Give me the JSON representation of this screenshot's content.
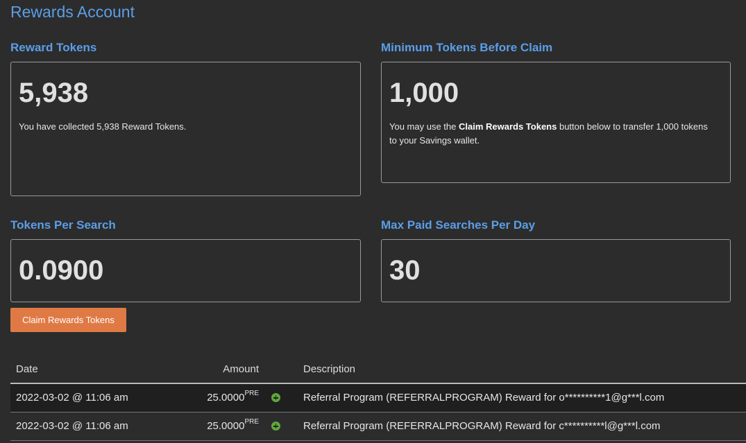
{
  "page": {
    "title": "Rewards Account"
  },
  "cards": {
    "reward_tokens": {
      "title": "Reward Tokens",
      "value": "5,938",
      "description": "You have collected 5,938 Reward Tokens."
    },
    "min_tokens": {
      "title": "Minimum Tokens Before Claim",
      "value": "1,000",
      "desc_prefix": "You may use the ",
      "desc_bold": "Claim Rewards Tokens",
      "desc_suffix": " button below to transfer 1,000 tokens to your Savings wallet."
    },
    "tokens_per_search": {
      "title": "Tokens Per Search",
      "value": "0.0900"
    },
    "max_paid_searches": {
      "title": "Max Paid Searches Per Day",
      "value": "30"
    }
  },
  "claim_button": {
    "label": "Claim Rewards Tokens",
    "color": "#e07a45"
  },
  "table": {
    "headers": {
      "date": "Date",
      "amount": "Amount",
      "description": "Description"
    },
    "rows": [
      {
        "date": "2022-03-02 @ 11:06 am",
        "amount": "25.0000",
        "unit": "PRE",
        "icon": "plus-circle-icon",
        "description": "Referral Program (REFERRALPROGRAM) Reward for o**********1@g***l.com"
      },
      {
        "date": "2022-03-02 @ 11:06 am",
        "amount": "25.0000",
        "unit": "PRE",
        "icon": "plus-circle-icon",
        "description": "Referral Program (REFERRALPROGRAM) Reward for c**********l@g***l.com"
      }
    ]
  },
  "colors": {
    "accent": "#5b9ee8",
    "background": "#2c2c2c",
    "positive": "#5fa83d"
  }
}
